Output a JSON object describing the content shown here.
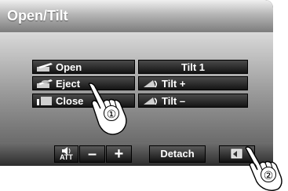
{
  "title": "Open/Tilt",
  "buttons": {
    "open": "Open",
    "eject": "Eject",
    "close": "Close",
    "tilt_1": "Tilt 1",
    "tilt_plus": "Tilt +",
    "tilt_minus": "Tilt –"
  },
  "bottom_bar": {
    "att": "ATT",
    "minus": "–",
    "plus": "+",
    "detach": "Detach"
  },
  "callouts": {
    "one": "①",
    "two": "②"
  },
  "icons": [
    "open-icon",
    "eject-icon",
    "close-icon",
    "tilt-plus-icon",
    "tilt-minus-icon",
    "speaker-icon",
    "back-icon",
    "pointing-hand-icon"
  ]
}
